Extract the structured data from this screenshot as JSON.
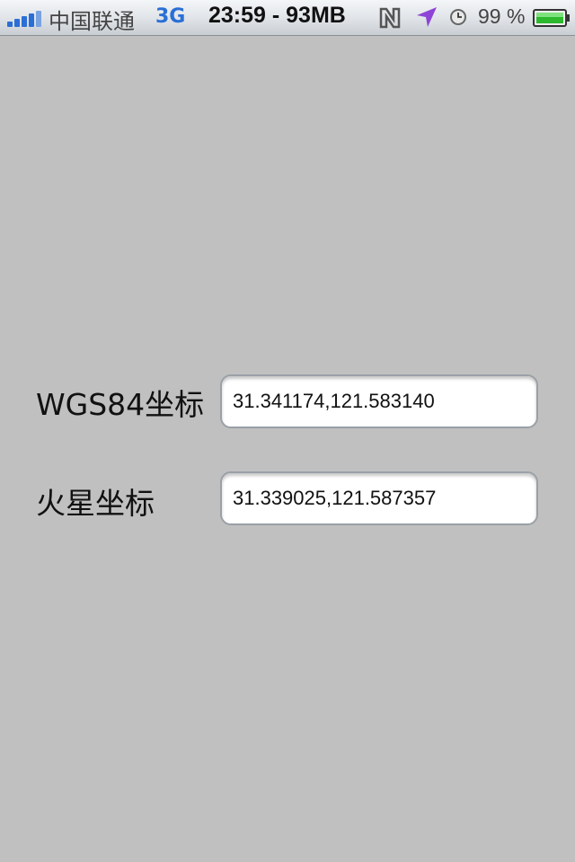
{
  "status_bar": {
    "carrier": "中国联通",
    "network": "3G",
    "time_memory": "23:59 - 93MB",
    "battery_percent": "99 %",
    "accent_color": "#2a6fd6"
  },
  "form": {
    "wgs84": {
      "label": "WGS84坐标",
      "value": "31.341174,121.583140"
    },
    "mars": {
      "label": "火星坐标",
      "value": "31.339025,121.587357"
    }
  },
  "icons": [
    "signal-strength-icon",
    "n-app-icon",
    "location-arrow-icon",
    "alarm-clock-icon",
    "battery-icon"
  ]
}
